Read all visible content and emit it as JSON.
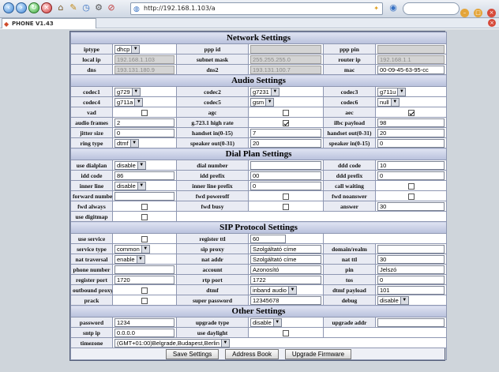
{
  "browser": {
    "url": "http://192.168.1.103/a",
    "tab_title": "PHONE V1.43"
  },
  "colors": {
    "section_header": "#c3c9e1",
    "panel_bg": "#eef0f6",
    "disabled_input": "#d4d4d4"
  },
  "network": {
    "header": "Network Settings",
    "iptype_label": "iptype",
    "iptype_value": "dhcp",
    "pppid_label": "ppp id",
    "pppid_value": "",
    "ppppin_label": "ppp pin",
    "ppppin_value": "",
    "localip_label": "local ip",
    "localip_value": "192.168.1.103",
    "subnet_label": "subnet mask",
    "subnet_value": "255.255.255.0",
    "router_label": "router ip",
    "router_value": "192.168.1.1",
    "dns_label": "dns",
    "dns_value": "193.131.180.9",
    "dns2_label": "dns2",
    "dns2_value": "193.131.100.7",
    "mac_label": "mac",
    "mac_value": "00-09-45-63-95-cc"
  },
  "audio": {
    "header": "Audio Settings",
    "codec1_label": "codec1",
    "codec1_value": "g729",
    "codec2_label": "codec2",
    "codec2_value": "g7231",
    "codec3_label": "codec3",
    "codec3_value": "g711u",
    "codec4_label": "codec4",
    "codec4_value": "g711a",
    "codec5_label": "codec5",
    "codec5_value": "gsm",
    "codec6_label": "codec6",
    "codec6_value": "null",
    "vad_label": "vad",
    "agc_label": "agc",
    "aec_label": "aec",
    "frames_label": "audio frames",
    "frames_value": "2",
    "g7231_label": "g.723.1 high rate",
    "ilbc_label": "ilbc payload",
    "ilbc_value": "98",
    "jitter_label": "jitter size",
    "jitter_value": "0",
    "handsetin_label": "handset in(0-15)",
    "handsetin_value": "7",
    "handsetout_label": "handset out(0-31)",
    "handsetout_value": "20",
    "ring_label": "ring type",
    "ring_value": "dtmf",
    "speakerout_label": "speaker out(0-31)",
    "speakerout_value": "20",
    "speakerin_label": "speaker in(0-15)",
    "speakerin_value": "0"
  },
  "dialplan": {
    "header": "Dial Plan Settings",
    "usedial_label": "use dialplan",
    "usedial_value": "disable",
    "dialnum_label": "dial number",
    "dialnum_value": "",
    "dddcode_label": "ddd code",
    "dddcode_value": "10",
    "iddcode_label": "idd code",
    "iddcode_value": "86",
    "iddprefix_label": "idd prefix",
    "iddprefix_value": "00",
    "dddprefix_label": "ddd prefix",
    "dddprefix_value": "0",
    "innerline_label": "inner line",
    "innerline_value": "disable",
    "innerprefix_label": "inner line prefix",
    "innerprefix_value": "0",
    "callwaiting_label": "call waiting",
    "fwdnum_label": "forward number",
    "fwdnum_value": "",
    "poweroff_label": "fwd poweroff",
    "noanswer_label": "fwd noanswer",
    "always_label": "fwd always",
    "busy_label": "fwd busy",
    "answer_label": "answer",
    "answer_value": "30",
    "digitmap_label": "use digitmap"
  },
  "sip": {
    "header": "SIP Protocol Settings",
    "useservice_label": "use service",
    "regttl_label": "register ttl",
    "regttl_value": "60",
    "servicetype_label": "service type",
    "servicetype_value": "common",
    "sipproxy_label": "sip proxy",
    "sipproxy_value": "Szolgáltató címe",
    "domain_label": "domain/realm",
    "domain_value": "",
    "nattrav_label": "nat traversal",
    "nattrav_value": "enable",
    "nataddr_label": "nat addr",
    "nataddr_value": "Szolgáltató címe",
    "natttl_label": "nat ttl",
    "natttl_value": "30",
    "phonenum_label": "phone number",
    "phonenum_value": "",
    "account_label": "account",
    "account_value": "Azonosító",
    "pin_label": "pin",
    "pin_value": "Jelszó",
    "regport_label": "register port",
    "regport_value": "1720",
    "rtpport_label": "rtp port",
    "rtpport_value": "1722",
    "tos_label": "tos",
    "tos_value": "0",
    "outproxy_label": "outbound proxy",
    "dtmf_label": "dtmf",
    "dtmf_value": "inband audio",
    "dtmfpayload_label": "dtmf payload",
    "dtmfpayload_value": "101",
    "prack_label": "prack",
    "superpass_label": "super password",
    "superpass_value": "12345678",
    "debug_label": "debug",
    "debug_value": "disable"
  },
  "other": {
    "header": "Other Settings",
    "password_label": "password",
    "password_value": "1234",
    "upgradetype_label": "upgrade type",
    "upgradetype_value": "disable",
    "upgradeaddr_label": "upgrade addr",
    "upgradeaddr_value": "",
    "sntp_label": "sntp ip",
    "sntp_value": "0.0.0.0",
    "daylight_label": "use daylight",
    "timezone_label": "timezone",
    "timezone_value": "(GMT+01:00)Belgrade,Budapest,Berlin"
  },
  "buttons": {
    "save": "Save Settings",
    "addressbook": "Address Book",
    "upgrade": "Upgrade Firmware"
  }
}
